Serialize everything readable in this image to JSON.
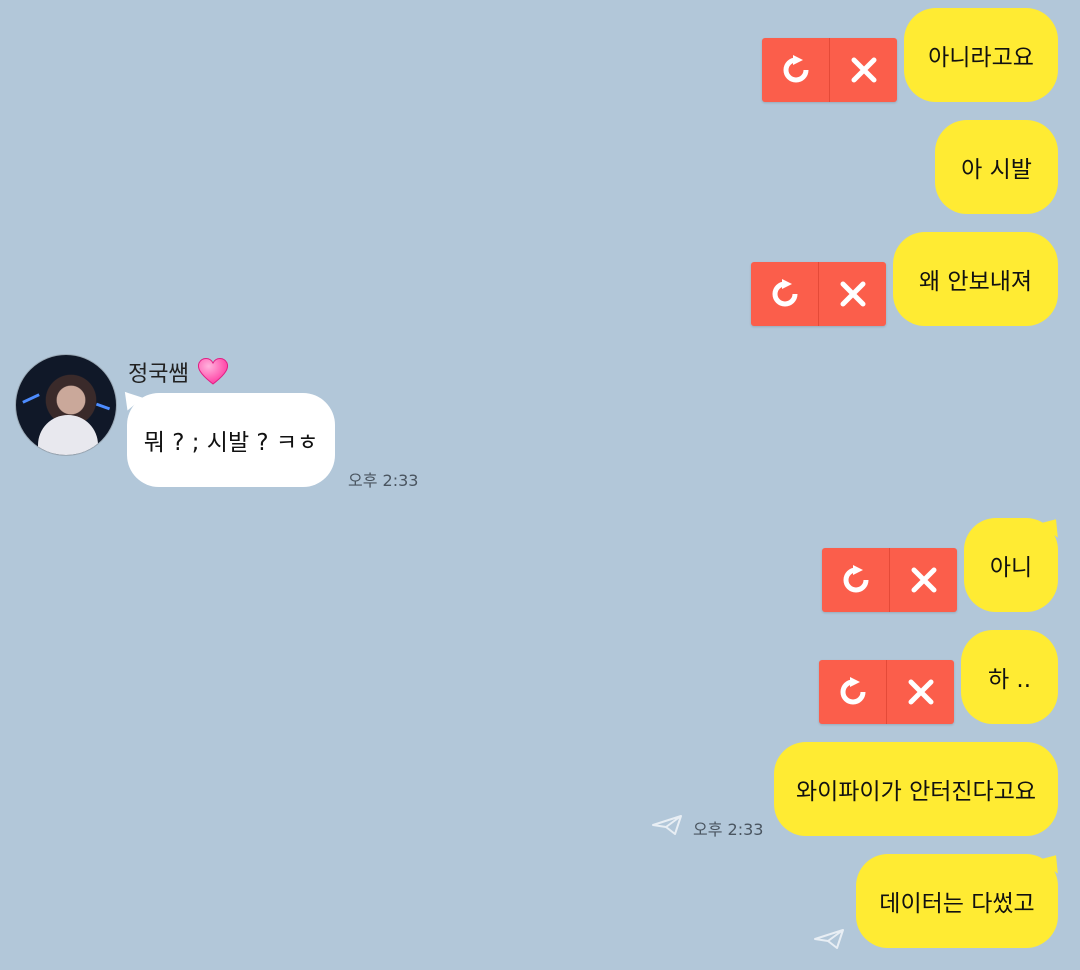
{
  "colors": {
    "background": "#b2c7d9",
    "my_bubble": "#ffeb33",
    "their_bubble": "#ffffff",
    "failed_action": "#fb5e4b"
  },
  "icons": {
    "retry": "retry-icon",
    "delete": "close-icon",
    "sent": "paper-plane-icon",
    "heart": "pink-heart-emoji"
  },
  "messages": [
    {
      "text": "아니라고요",
      "failed": true
    },
    {
      "text": "아 시발",
      "failed": false
    },
    {
      "text": "왜 안보내져",
      "failed": true
    }
  ],
  "incoming": {
    "sender": "정국쌤",
    "text": "뭐 ? ; 시발 ? ㅋㅎ",
    "time": "오후 2:33"
  },
  "later_messages": [
    {
      "text": "아니",
      "failed": true
    },
    {
      "text": "하 ..",
      "failed": true
    },
    {
      "text": "와이파이가 안터진다고요",
      "failed": false,
      "time": "오후 2:33"
    },
    {
      "text": "데이터는 다썼고",
      "failed": false
    }
  ]
}
